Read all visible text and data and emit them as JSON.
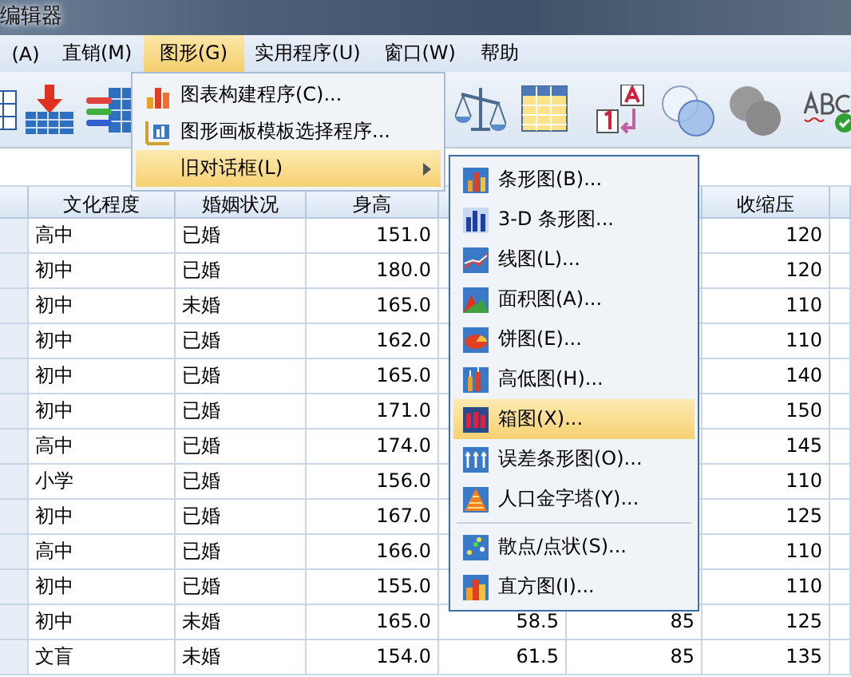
{
  "window": {
    "title": "编辑器"
  },
  "menu_bar": [
    {
      "label": "(A)",
      "selected": false
    },
    {
      "label": "直销(M)",
      "selected": false
    },
    {
      "label": "图形(G)",
      "selected": true
    },
    {
      "label": "实用程序(U)",
      "selected": false
    },
    {
      "label": "窗口(W)",
      "selected": false
    },
    {
      "label": "帮助",
      "selected": false
    }
  ],
  "table": {
    "columns": [
      {
        "label": "文化程度"
      },
      {
        "label": "婚姻状况"
      },
      {
        "label": "身高"
      },
      {},
      {},
      {
        "label": "收缩压"
      }
    ],
    "rows": [
      {
        "cells": [
          "高中",
          "已婚",
          "151.0",
          null,
          null,
          "120"
        ]
      },
      {
        "cells": [
          "初中",
          "已婚",
          "180.0",
          null,
          null,
          "120"
        ]
      },
      {
        "cells": [
          "初中",
          "未婚",
          "165.0",
          null,
          null,
          "110"
        ]
      },
      {
        "cells": [
          "初中",
          "已婚",
          "162.0",
          null,
          null,
          "110"
        ]
      },
      {
        "cells": [
          "初中",
          "已婚",
          "165.0",
          null,
          null,
          "140"
        ]
      },
      {
        "cells": [
          "初中",
          "已婚",
          "171.0",
          null,
          null,
          "150"
        ]
      },
      {
        "cells": [
          "高中",
          "已婚",
          "174.0",
          null,
          null,
          "145"
        ]
      },
      {
        "cells": [
          "小学",
          "已婚",
          "156.0",
          null,
          null,
          "110"
        ]
      },
      {
        "cells": [
          "初中",
          "已婚",
          "167.0",
          null,
          null,
          "125"
        ]
      },
      {
        "cells": [
          "高中",
          "已婚",
          "166.0",
          null,
          null,
          "110"
        ]
      },
      {
        "cells": [
          "初中",
          "已婚",
          "155.0",
          null,
          null,
          "110"
        ]
      },
      {
        "cells": [
          "初中",
          "未婚",
          "165.0",
          "58.5",
          "85",
          "125"
        ]
      },
      {
        "cells": [
          "文盲",
          "未婚",
          "154.0",
          "61.5",
          "85",
          "135"
        ]
      }
    ]
  },
  "graph_menu": {
    "items": [
      {
        "label": "图表构建程序(C)...",
        "kind": "item",
        "selected": false
      },
      {
        "label": "图形画板模板选择程序...",
        "kind": "item",
        "selected": false
      },
      {
        "label": "旧对话框(L)",
        "kind": "submenu",
        "selected": true
      }
    ]
  },
  "legacy_dialogs_menu": {
    "items": [
      {
        "label": "条形图(B)...",
        "kind": "item",
        "selected": false
      },
      {
        "label": "3-D 条形图...",
        "kind": "item",
        "selected": false
      },
      {
        "label": "线图(L)...",
        "kind": "item",
        "selected": false
      },
      {
        "label": "面积图(A)...",
        "kind": "item",
        "selected": false
      },
      {
        "label": "饼图(E)...",
        "kind": "item",
        "selected": false
      },
      {
        "label": "高低图(H)...",
        "kind": "item",
        "selected": false
      },
      {
        "label": "箱图(X)...",
        "kind": "item",
        "selected": true
      },
      {
        "label": "误差条形图(O)...",
        "kind": "item",
        "selected": false
      },
      {
        "label": "人口金字塔(Y)...",
        "kind": "item",
        "selected": false
      },
      {
        "kind": "separator"
      },
      {
        "label": "散点/点状(S)...",
        "kind": "item",
        "selected": false
      },
      {
        "label": "直方图(I)...",
        "kind": "item",
        "selected": false
      }
    ]
  }
}
